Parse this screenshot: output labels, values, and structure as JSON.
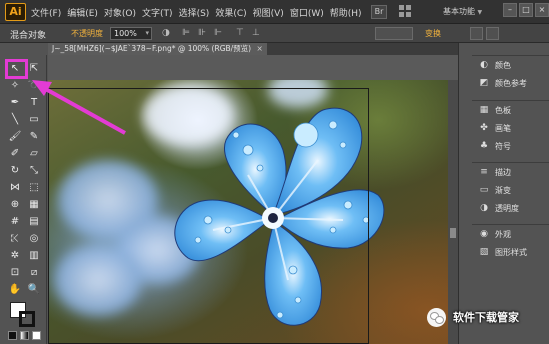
{
  "app": {
    "logo_text": "Ai"
  },
  "menu": {
    "items": [
      "文件(F)",
      "编辑(E)",
      "对象(O)",
      "文字(T)",
      "选择(S)",
      "效果(C)",
      "视图(V)",
      "窗口(W)",
      "帮助(H)"
    ],
    "bridge_label": "Br",
    "workspace_label": "基本功能",
    "window_controls": [
      "–",
      "□",
      "×"
    ]
  },
  "control_bar": {
    "selection_status": "混合对象",
    "opacity_label": "不透明度",
    "opacity_value": "100%",
    "transform_label": "变换"
  },
  "document_tab": {
    "title": "J~_58[MHZ6](~$JAE`378~F.png* @ 100% (RGB/预览)",
    "close_label": "×"
  },
  "tools": [
    {
      "name": "selection-tool",
      "icon": "arrow-icon",
      "glyph": "↖"
    },
    {
      "name": "direct-selection-tool",
      "icon": "white-arrow-icon",
      "glyph": "⇱"
    },
    {
      "name": "magic-wand-tool",
      "icon": "wand-icon",
      "glyph": "✧"
    },
    {
      "name": "lasso-tool",
      "icon": "lasso-icon",
      "glyph": "➰"
    },
    {
      "name": "pen-tool",
      "icon": "pen-icon",
      "glyph": "✒"
    },
    {
      "name": "type-tool",
      "icon": "type-icon",
      "glyph": "T"
    },
    {
      "name": "line-tool",
      "icon": "line-icon",
      "glyph": "╲"
    },
    {
      "name": "rectangle-tool",
      "icon": "rectangle-icon",
      "glyph": "▭"
    },
    {
      "name": "paintbrush-tool",
      "icon": "brush-icon",
      "glyph": "🖌"
    },
    {
      "name": "pencil-tool",
      "icon": "pencil-icon",
      "glyph": "✎"
    },
    {
      "name": "blob-brush-tool",
      "icon": "blob-brush-icon",
      "glyph": "✐"
    },
    {
      "name": "eraser-tool",
      "icon": "eraser-icon",
      "glyph": "▱"
    },
    {
      "name": "rotate-tool",
      "icon": "rotate-icon",
      "glyph": "↻"
    },
    {
      "name": "scale-tool",
      "icon": "scale-icon",
      "glyph": "⤡"
    },
    {
      "name": "width-tool",
      "icon": "width-icon",
      "glyph": "⋈"
    },
    {
      "name": "free-transform-tool",
      "icon": "free-transform-icon",
      "glyph": "⬚"
    },
    {
      "name": "shape-builder-tool",
      "icon": "shape-builder-icon",
      "glyph": "⊕"
    },
    {
      "name": "perspective-grid-tool",
      "icon": "perspective-icon",
      "glyph": "▦"
    },
    {
      "name": "mesh-tool",
      "icon": "mesh-icon",
      "glyph": "#"
    },
    {
      "name": "gradient-tool",
      "icon": "gradient-icon",
      "glyph": "▤"
    },
    {
      "name": "eyedropper-tool",
      "icon": "eyedropper-icon",
      "glyph": "⤪"
    },
    {
      "name": "blend-tool",
      "icon": "blend-icon",
      "glyph": "◎"
    },
    {
      "name": "symbol-sprayer-tool",
      "icon": "symbol-sprayer-icon",
      "glyph": "✲"
    },
    {
      "name": "column-graph-tool",
      "icon": "graph-icon",
      "glyph": "▥"
    },
    {
      "name": "artboard-tool",
      "icon": "artboard-icon",
      "glyph": "⊡"
    },
    {
      "name": "slice-tool",
      "icon": "slice-icon",
      "glyph": "⧄"
    },
    {
      "name": "hand-tool",
      "icon": "hand-icon",
      "glyph": "✋"
    },
    {
      "name": "zoom-tool",
      "icon": "zoom-icon",
      "glyph": "🔍"
    }
  ],
  "panels": {
    "group1": [
      {
        "name": "color",
        "label": "颜色",
        "icon": "color-icon",
        "glyph": "◐"
      },
      {
        "name": "color-guide",
        "label": "颜色参考",
        "icon": "color-guide-icon",
        "glyph": "◩"
      }
    ],
    "group2": [
      {
        "name": "swatches",
        "label": "色板",
        "icon": "swatches-icon",
        "glyph": "▦"
      },
      {
        "name": "brushes",
        "label": "画笔",
        "icon": "brushes-icon",
        "glyph": "✤"
      },
      {
        "name": "symbols",
        "label": "符号",
        "icon": "symbols-icon",
        "glyph": "♣"
      }
    ],
    "group3": [
      {
        "name": "stroke",
        "label": "描边",
        "icon": "stroke-icon",
        "glyph": "≡"
      },
      {
        "name": "gradient",
        "label": "渐变",
        "icon": "gradient-panel-icon",
        "glyph": "▭"
      },
      {
        "name": "transparency",
        "label": "透明度",
        "icon": "transparency-icon",
        "glyph": "◑"
      }
    ],
    "group4": [
      {
        "name": "appearance",
        "label": "外观",
        "icon": "appearance-icon",
        "glyph": "◉"
      },
      {
        "name": "graphic-styles",
        "label": "图形样式",
        "icon": "graphic-styles-icon",
        "glyph": "▧"
      }
    ]
  },
  "watermark": {
    "text": "软件下载管家"
  },
  "colors": {
    "highlight": "#e33bd4",
    "accent_orange": "#f3b33d",
    "flower_blue": "#4aa6ec"
  }
}
